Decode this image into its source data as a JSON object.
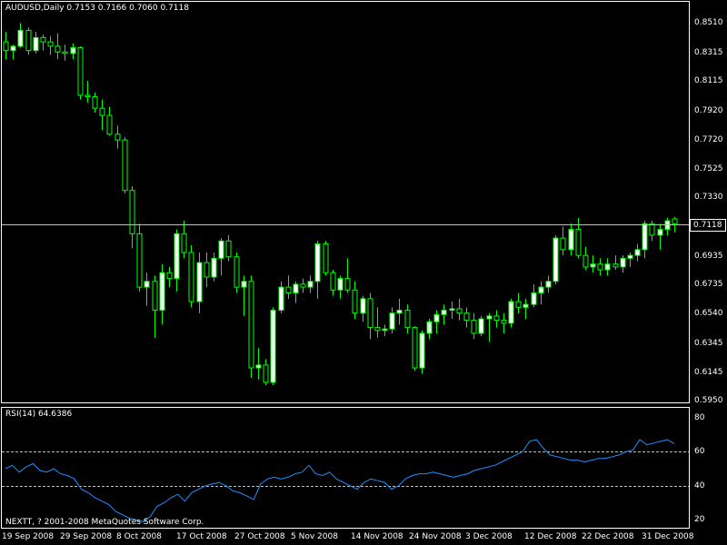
{
  "window": {
    "title": "AUDUSD,Daily  0.7153 0.7166 0.7060 0.7118",
    "colors": {
      "background": "#000000",
      "frame": "#ffffff",
      "bull_candle": "#ffffff",
      "bear_candle": "#000000",
      "candle_line": "#00ff00",
      "rsi_line": "#1e90ff"
    }
  },
  "price_axis": {
    "labels": [
      "0.8510",
      "0.8315",
      "0.8115",
      "0.7920",
      "0.7720",
      "0.7525",
      "0.7330",
      "0.7118",
      "0.6935",
      "0.6735",
      "0.6540",
      "0.6345",
      "0.6145",
      "0.5950"
    ],
    "last_price": "0.7118"
  },
  "rsi": {
    "title": "RSI(14) 64.6386",
    "axis_labels": [
      "80",
      "60",
      "40",
      "20"
    ]
  },
  "footer": {
    "text": "NEXTT, ? 2001-2008 MetaQuotes Software Corp."
  },
  "time_axis": {
    "labels": [
      "19 Sep 2008",
      "29 Sep 2008",
      "8 Oct 2008",
      "17 Oct 2008",
      "27 Oct 2008",
      "5 Nov 2008",
      "14 Nov 2008",
      "24 Nov 2008",
      "3 Dec 2008",
      "12 Dec 2008",
      "22 Dec 2008",
      "31 Dec 2008"
    ]
  },
  "chart_data": [
    {
      "type": "candlestick",
      "title": "AUDUSD,Daily  0.7153 0.7166 0.7060 0.7118",
      "ylim": [
        0.59,
        0.862
      ],
      "last_price_line": 0.7118,
      "x_labels": [
        "19 Sep 2008",
        "29 Sep 2008",
        "8 Oct 2008",
        "17 Oct 2008",
        "27 Oct 2008",
        "5 Nov 2008",
        "14 Nov 2008",
        "24 Nov 2008",
        "3 Dec 2008",
        "12 Dec 2008",
        "22 Dec 2008",
        "31 Dec 2008"
      ],
      "ohlc": [
        [
          0.838,
          0.845,
          0.826,
          0.832
        ],
        [
          0.832,
          0.836,
          0.826,
          0.835
        ],
        [
          0.835,
          0.851,
          0.834,
          0.846
        ],
        [
          0.846,
          0.848,
          0.829,
          0.832
        ],
        [
          0.832,
          0.845,
          0.83,
          0.841
        ],
        [
          0.841,
          0.843,
          0.832,
          0.838
        ],
        [
          0.838,
          0.842,
          0.829,
          0.835
        ],
        [
          0.835,
          0.844,
          0.826,
          0.831
        ],
        [
          0.831,
          0.836,
          0.825,
          0.83
        ],
        [
          0.83,
          0.837,
          0.826,
          0.834
        ],
        [
          0.834,
          0.835,
          0.798,
          0.801
        ],
        [
          0.801,
          0.811,
          0.796,
          0.8
        ],
        [
          0.8,
          0.803,
          0.789,
          0.792
        ],
        [
          0.792,
          0.798,
          0.777,
          0.787
        ],
        [
          0.787,
          0.793,
          0.773,
          0.774
        ],
        [
          0.774,
          0.78,
          0.764,
          0.77
        ],
        [
          0.77,
          0.772,
          0.733,
          0.735
        ],
        [
          0.735,
          0.738,
          0.695,
          0.705
        ],
        [
          0.705,
          0.712,
          0.665,
          0.668
        ],
        [
          0.668,
          0.678,
          0.655,
          0.672
        ],
        [
          0.672,
          0.676,
          0.633,
          0.652
        ],
        [
          0.652,
          0.684,
          0.642,
          0.678
        ],
        [
          0.678,
          0.682,
          0.668,
          0.674
        ],
        [
          0.674,
          0.708,
          0.665,
          0.705
        ],
        [
          0.705,
          0.714,
          0.688,
          0.692
        ],
        [
          0.692,
          0.697,
          0.654,
          0.658
        ],
        [
          0.658,
          0.692,
          0.65,
          0.685
        ],
        [
          0.685,
          0.692,
          0.668,
          0.675
        ],
        [
          0.675,
          0.692,
          0.672,
          0.688
        ],
        [
          0.688,
          0.702,
          0.676,
          0.7
        ],
        [
          0.7,
          0.704,
          0.686,
          0.689
        ],
        [
          0.689,
          0.692,
          0.664,
          0.668
        ],
        [
          0.668,
          0.676,
          0.648,
          0.672
        ],
        [
          0.672,
          0.676,
          0.605,
          0.612
        ],
        [
          0.612,
          0.626,
          0.604,
          0.614
        ],
        [
          0.614,
          0.618,
          0.6,
          0.602
        ],
        [
          0.602,
          0.654,
          0.6,
          0.652
        ],
        [
          0.652,
          0.672,
          0.65,
          0.668
        ],
        [
          0.668,
          0.676,
          0.66,
          0.664
        ],
        [
          0.664,
          0.672,
          0.657,
          0.67
        ],
        [
          0.67,
          0.674,
          0.664,
          0.668
        ],
        [
          0.668,
          0.676,
          0.664,
          0.672
        ],
        [
          0.672,
          0.7,
          0.66,
          0.698
        ],
        [
          0.698,
          0.7,
          0.676,
          0.678
        ],
        [
          0.678,
          0.68,
          0.662,
          0.666
        ],
        [
          0.666,
          0.676,
          0.66,
          0.674
        ],
        [
          0.674,
          0.688,
          0.664,
          0.666
        ],
        [
          0.666,
          0.672,
          0.646,
          0.65
        ],
        [
          0.65,
          0.662,
          0.644,
          0.66
        ],
        [
          0.66,
          0.664,
          0.632,
          0.64
        ],
        [
          0.64,
          0.654,
          0.633,
          0.638
        ],
        [
          0.638,
          0.642,
          0.634,
          0.639
        ],
        [
          0.639,
          0.654,
          0.636,
          0.65
        ],
        [
          0.65,
          0.66,
          0.642,
          0.652
        ],
        [
          0.652,
          0.656,
          0.636,
          0.64
        ],
        [
          0.64,
          0.641,
          0.61,
          0.612
        ],
        [
          0.612,
          0.638,
          0.608,
          0.636
        ],
        [
          0.636,
          0.646,
          0.632,
          0.644
        ],
        [
          0.644,
          0.652,
          0.636,
          0.649
        ],
        [
          0.649,
          0.656,
          0.642,
          0.652
        ],
        [
          0.652,
          0.658,
          0.646,
          0.653
        ],
        [
          0.653,
          0.66,
          0.645,
          0.65
        ],
        [
          0.65,
          0.654,
          0.64,
          0.645
        ],
        [
          0.645,
          0.65,
          0.632,
          0.636
        ],
        [
          0.636,
          0.648,
          0.634,
          0.646
        ],
        [
          0.646,
          0.65,
          0.63,
          0.648
        ],
        [
          0.648,
          0.652,
          0.64,
          0.645
        ],
        [
          0.645,
          0.65,
          0.636,
          0.643
        ],
        [
          0.643,
          0.66,
          0.64,
          0.658
        ],
        [
          0.658,
          0.664,
          0.65,
          0.654
        ],
        [
          0.654,
          0.66,
          0.646,
          0.656
        ],
        [
          0.656,
          0.67,
          0.654,
          0.664
        ],
        [
          0.664,
          0.672,
          0.656,
          0.668
        ],
        [
          0.668,
          0.676,
          0.664,
          0.672
        ],
        [
          0.672,
          0.704,
          0.67,
          0.702
        ],
        [
          0.702,
          0.71,
          0.69,
          0.694
        ],
        [
          0.694,
          0.712,
          0.69,
          0.708
        ],
        [
          0.708,
          0.716,
          0.688,
          0.69
        ],
        [
          0.69,
          0.696,
          0.68,
          0.682
        ],
        [
          0.682,
          0.69,
          0.678,
          0.684
        ],
        [
          0.684,
          0.688,
          0.676,
          0.68
        ],
        [
          0.68,
          0.688,
          0.676,
          0.684
        ],
        [
          0.684,
          0.69,
          0.68,
          0.682
        ],
        [
          0.682,
          0.69,
          0.678,
          0.688
        ],
        [
          0.688,
          0.692,
          0.682,
          0.69
        ],
        [
          0.69,
          0.698,
          0.686,
          0.694
        ],
        [
          0.694,
          0.714,
          0.688,
          0.712
        ],
        [
          0.712,
          0.714,
          0.7,
          0.704
        ],
        [
          0.704,
          0.712,
          0.694,
          0.708
        ],
        [
          0.708,
          0.716,
          0.704,
          0.714
        ],
        [
          0.7153,
          0.7166,
          0.706,
          0.7118
        ]
      ]
    },
    {
      "type": "line",
      "title": "RSI(14) 64.6386",
      "ylim": [
        16,
        84
      ],
      "levels": [
        40,
        60
      ],
      "series": [
        {
          "values": [
            50,
            52,
            48,
            51,
            53,
            49,
            48,
            50,
            47,
            46,
            44,
            38,
            36,
            33,
            31,
            29,
            25,
            23,
            21,
            20,
            19,
            22,
            28,
            30,
            33,
            35,
            31,
            36,
            38,
            40,
            41,
            42,
            40,
            37,
            36,
            34,
            32,
            41,
            44,
            45,
            44,
            45,
            47,
            48,
            52,
            47,
            46,
            48,
            44,
            42,
            40,
            38,
            42,
            44,
            43,
            42,
            38,
            40,
            44,
            46,
            47,
            47,
            48,
            47,
            46,
            45,
            46,
            47,
            49,
            50,
            51,
            52,
            54,
            56,
            58,
            60,
            66,
            67,
            62,
            58,
            57,
            56,
            55,
            55,
            54,
            55,
            56,
            56,
            57,
            58,
            60,
            61,
            67,
            64,
            65,
            66,
            67,
            64.6386
          ]
        }
      ]
    }
  ]
}
